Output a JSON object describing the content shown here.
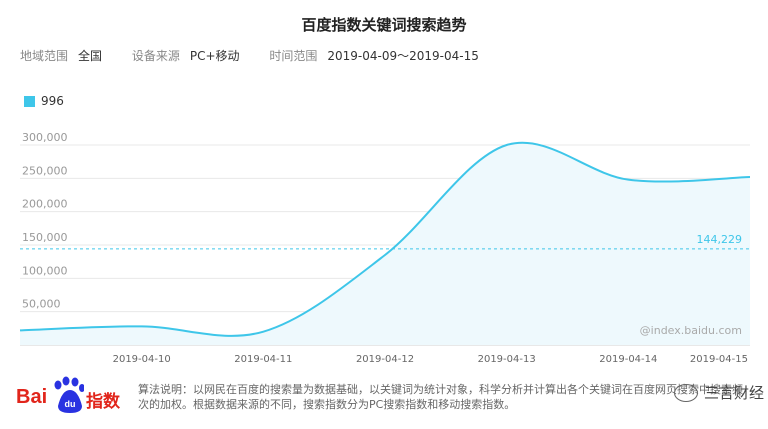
{
  "header": {
    "title": "百度指数关键词搜索趋势",
    "region_label": "地域范围",
    "region_value": "全国",
    "source_label": "设备来源",
    "source_value": "PC+移动",
    "time_label": "时间范围",
    "time_value": "2019-04-09～2019-04-15"
  },
  "footer": {
    "logo_text": "Bai",
    "logo_du": "du",
    "logo_index": "指数",
    "note": "算法说明：以网民在百度的搜索量为数据基础，以关键词为统计对象，科学分析并计算出各个关键词在百度网页搜索中搜索频次的加权。根据数据来源的不同，搜索指数分为PC搜索指数和移动搜索指数。",
    "watermark": "三言财经"
  },
  "colors": {
    "line": "#3ec6e9",
    "fill": "#eef9fd",
    "avg": "#3ec6e9"
  },
  "chart_data": {
    "type": "line",
    "legend": "996",
    "x": [
      "2019-04-09",
      "2019-04-10",
      "2019-04-11",
      "2019-04-12",
      "2019-04-13",
      "2019-04-14",
      "2019-04-15"
    ],
    "x_ticks": [
      "2019-04-10",
      "2019-04-11",
      "2019-04-12",
      "2019-04-13",
      "2019-04-14",
      "2019-04-15"
    ],
    "series": [
      {
        "name": "996",
        "values": [
          22000,
          28000,
          20000,
          135000,
          300000,
          248000,
          252000
        ]
      }
    ],
    "y_ticks": [
      50000,
      100000,
      150000,
      200000,
      250000,
      300000
    ],
    "y_tick_labels": [
      "50,000",
      "100,000",
      "150,000",
      "200,000",
      "250,000",
      "300,000"
    ],
    "ylim": [
      0,
      300000
    ],
    "average": 144229,
    "average_label": "144,229",
    "source_mark": "@index.baidu.com"
  }
}
